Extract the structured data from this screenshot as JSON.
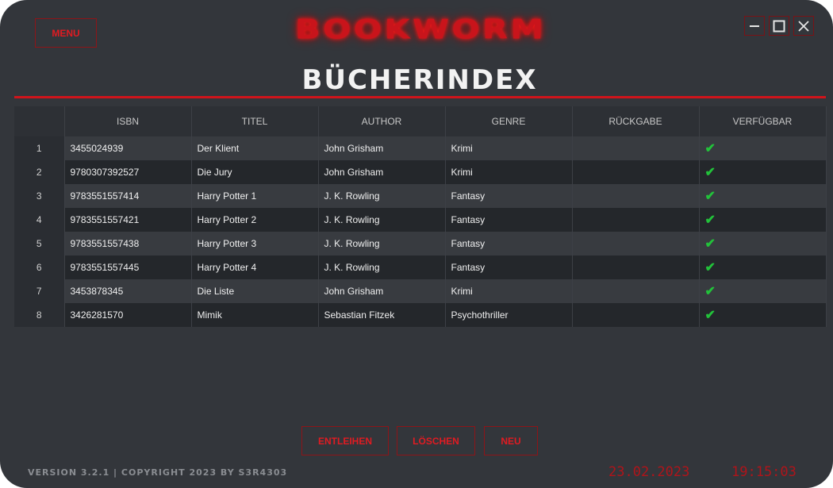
{
  "header": {
    "menu_label": "MENU",
    "brand": "BOOKWORM",
    "page_title": "BÜCHERINDEX"
  },
  "colors": {
    "accent": "#d0141b",
    "background": "#33363b",
    "check": "#22c23a"
  },
  "table": {
    "columns": [
      "",
      "ISBN",
      "TITEL",
      "AUTHOR",
      "GENRE",
      "RÜCKGABE",
      "VERFÜGBAR"
    ],
    "rows": [
      {
        "num": "1",
        "isbn": "3455024939",
        "title": "Der Klient",
        "author": "John Grisham",
        "genre": "Krimi",
        "return": "",
        "available": "✔"
      },
      {
        "num": "2",
        "isbn": "9780307392527",
        "title": "Die Jury",
        "author": "John Grisham",
        "genre": "Krimi",
        "return": "",
        "available": "✔"
      },
      {
        "num": "3",
        "isbn": "9783551557414",
        "title": "Harry Potter 1",
        "author": "J. K. Rowling",
        "genre": "Fantasy",
        "return": "",
        "available": "✔"
      },
      {
        "num": "4",
        "isbn": "9783551557421",
        "title": "Harry Potter 2",
        "author": "J. K. Rowling",
        "genre": "Fantasy",
        "return": "",
        "available": "✔"
      },
      {
        "num": "5",
        "isbn": "9783551557438",
        "title": "Harry Potter 3",
        "author": "J. K. Rowling",
        "genre": "Fantasy",
        "return": "",
        "available": "✔"
      },
      {
        "num": "6",
        "isbn": "9783551557445",
        "title": "Harry Potter 4",
        "author": "J. K. Rowling",
        "genre": "Fantasy",
        "return": "",
        "available": "✔"
      },
      {
        "num": "7",
        "isbn": "3453878345",
        "title": "Die Liste",
        "author": "John Grisham",
        "genre": "Krimi",
        "return": "",
        "available": "✔"
      },
      {
        "num": "8",
        "isbn": "3426281570",
        "title": "Mimik",
        "author": "Sebastian Fitzek",
        "genre": "Psychothriller",
        "return": "",
        "available": "✔"
      }
    ]
  },
  "actions": {
    "lend": "ENTLEIHEN",
    "delete": "LÖSCHEN",
    "new": "NEU"
  },
  "footer": {
    "version": "VERSION 3.2.1 | COPYRIGHT 2023 BY S3R4303",
    "date": "23.02.2023",
    "time": "19:15:03"
  }
}
